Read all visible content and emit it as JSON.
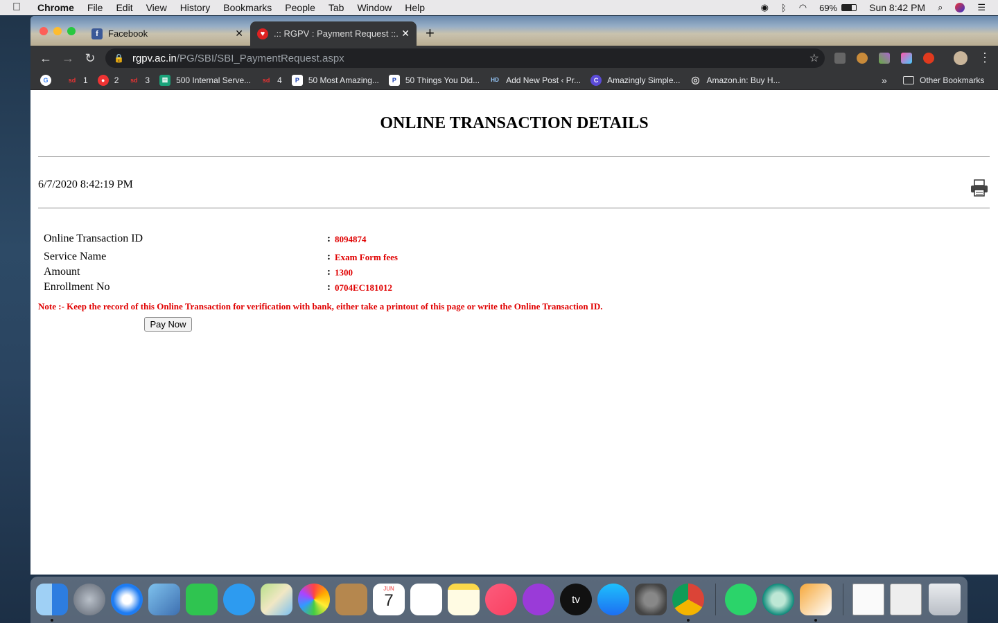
{
  "menubar": {
    "app": "Chrome",
    "items": [
      "File",
      "Edit",
      "View",
      "History",
      "Bookmarks",
      "People",
      "Tab",
      "Window",
      "Help"
    ],
    "battery": "69%",
    "clock": "Sun 8:42 PM"
  },
  "tabs": [
    {
      "title": "Facebook",
      "close": "✕"
    },
    {
      "title": ".:: RGPV : Payment Request ::.",
      "close": "✕"
    }
  ],
  "new_tab": "+",
  "toolbar": {
    "back": "←",
    "forward": "→",
    "reload": "↻",
    "url_host": "rgpv.ac.in",
    "url_path": "/PG/SBI/SBI_PaymentRequest.aspx",
    "star": "☆",
    "menu": "⋮"
  },
  "bookmarks": {
    "items": [
      {
        "label": "",
        "icon": "G"
      },
      {
        "label": "1",
        "icon": "sd"
      },
      {
        "label": "2",
        "icon": "●"
      },
      {
        "label": "3",
        "icon": "sd"
      },
      {
        "label": "500 Internal Serve...",
        "icon": "▤"
      },
      {
        "label": "4",
        "icon": "sd"
      },
      {
        "label": "50 Most Amazing...",
        "icon": "P"
      },
      {
        "label": "50 Things You Did...",
        "icon": "P"
      },
      {
        "label": "Add New Post ‹ Pr...",
        "icon": "HD"
      },
      {
        "label": "Amazingly Simple...",
        "icon": "C"
      },
      {
        "label": "Amazon.in: Buy H...",
        "icon": "◎"
      }
    ],
    "overflow": "»",
    "other": "Other Bookmarks"
  },
  "page": {
    "heading": "ONLINE TRANSACTION DETAILS",
    "datetime": "6/7/2020 8:42:19 PM",
    "rows": [
      {
        "label": "Online Transaction ID",
        "colon": ":",
        "value": "8094874"
      },
      {
        "label": "Service Name",
        "colon": ":",
        "value": "Exam Form fees"
      },
      {
        "label": "Amount",
        "colon": ":",
        "value": "1300"
      },
      {
        "label": "Enrollment No",
        "colon": ":",
        "value": "0704EC181012"
      }
    ],
    "note": "Note :- Keep the record of this Online Transaction for verification with bank, either take a printout of this page or write the Online Transaction ID.",
    "pay_button": "Pay Now"
  },
  "dock": {
    "calendar_month": "JUN",
    "calendar_day": "7",
    "tv_label": "tv"
  }
}
